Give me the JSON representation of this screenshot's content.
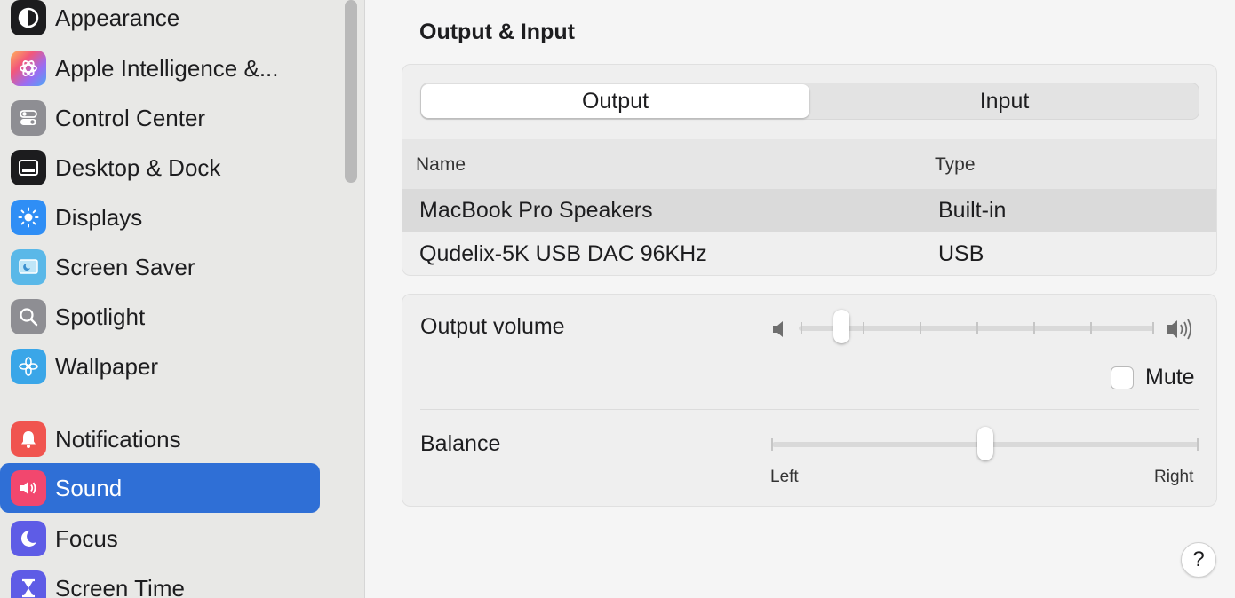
{
  "sidebar": {
    "items": [
      {
        "label": "Appearance",
        "icon": "appearance-icon"
      },
      {
        "label": "Apple Intelligence &...",
        "icon": "apple-intelligence-icon"
      },
      {
        "label": "Control Center",
        "icon": "control-center-icon"
      },
      {
        "label": "Desktop & Dock",
        "icon": "desktop-dock-icon"
      },
      {
        "label": "Displays",
        "icon": "displays-icon"
      },
      {
        "label": "Screen Saver",
        "icon": "screen-saver-icon"
      },
      {
        "label": "Spotlight",
        "icon": "spotlight-icon"
      },
      {
        "label": "Wallpaper",
        "icon": "wallpaper-icon"
      },
      {
        "label": "Notifications",
        "icon": "notifications-icon"
      },
      {
        "label": "Sound",
        "icon": "sound-icon",
        "selected": true
      },
      {
        "label": "Focus",
        "icon": "focus-icon"
      },
      {
        "label": "Screen Time",
        "icon": "screen-time-icon"
      }
    ]
  },
  "main": {
    "section_title": "Output & Input",
    "tabs": [
      {
        "label": "Output",
        "active": true
      },
      {
        "label": "Input",
        "active": false
      }
    ],
    "table": {
      "columns": [
        "Name",
        "Type"
      ],
      "rows": [
        {
          "name": "MacBook Pro Speakers",
          "type": "Built-in",
          "selected": true
        },
        {
          "name": "Qudelix-5K USB DAC 96KHz",
          "type": "USB",
          "selected": false
        }
      ]
    },
    "output_volume": {
      "label": "Output volume",
      "level": 0.12
    },
    "mute": {
      "label": "Mute",
      "checked": false
    },
    "balance": {
      "label": "Balance",
      "left_label": "Left",
      "right_label": "Right",
      "value": 0.5
    },
    "help_label": "?"
  },
  "colors": {
    "accent": "#2f6fd6",
    "sidebar_bg": "#e8e8e6",
    "window_bg": "#f5f5f5"
  }
}
